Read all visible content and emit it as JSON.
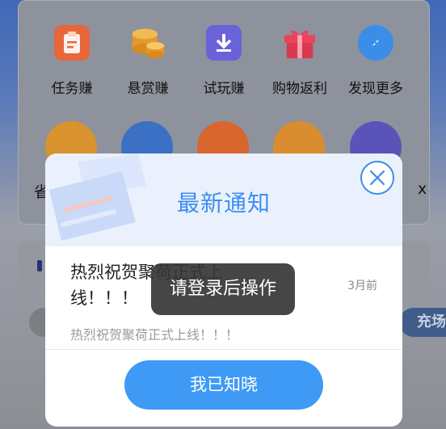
{
  "grid": {
    "row1": [
      {
        "label": "任务赚",
        "icon": "task-clipboard-icon",
        "color": "#e8663a"
      },
      {
        "label": "悬赏赚",
        "icon": "coins-stack-icon",
        "color": "#e8a93a"
      },
      {
        "label": "试玩赚",
        "icon": "download-icon",
        "color": "#6a62d8"
      },
      {
        "label": "购物返利",
        "icon": "gift-box-icon",
        "color": "#e8455a"
      },
      {
        "label": "发现更多",
        "icon": "compass-icon",
        "color": "#3a8de8"
      }
    ],
    "row2_partial_left": "省",
    "row2_partial_right": "x"
  },
  "background": {
    "charge_button": "充场"
  },
  "modal": {
    "title": "最新通知",
    "notice": {
      "title": "热烈祝贺聚荷正式上线！！！",
      "time": "3月前",
      "description": "热烈祝贺聚荷正式上线！！！"
    },
    "confirm_label": "我已知晓"
  },
  "toast": {
    "message": "请登录后操作"
  },
  "colors": {
    "accent": "#3e9af5",
    "title_blue": "#3d8ef0"
  }
}
